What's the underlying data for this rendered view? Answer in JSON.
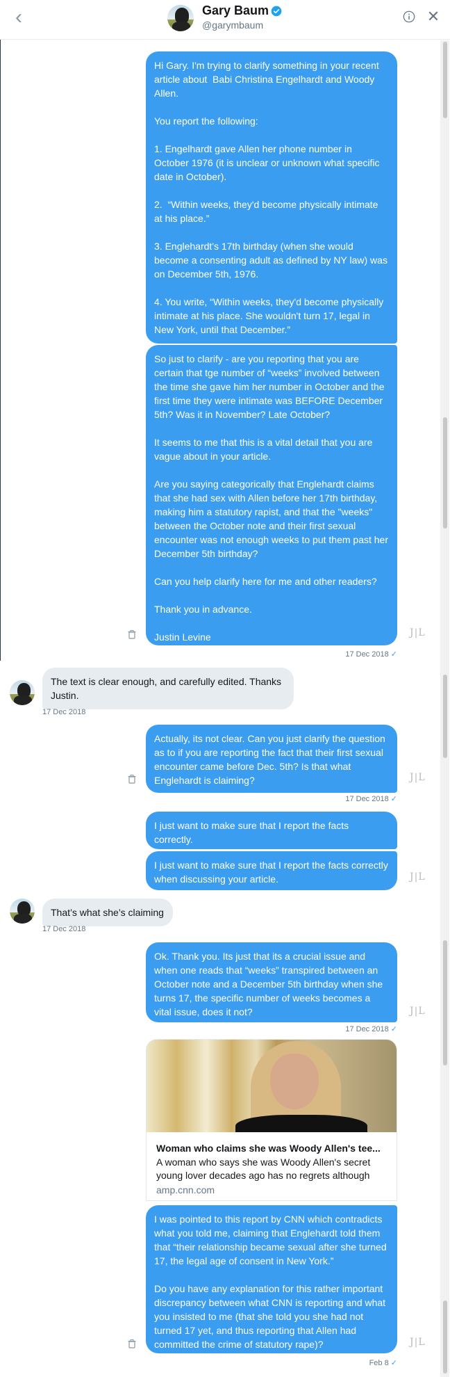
{
  "header": {
    "name": "Gary Baum",
    "handle": "@garymbaum"
  },
  "messages": {
    "m1a": "Hi Gary. I'm trying to clarify something in your recent article about  Babi Christina Engelhardt and Woody Allen.\n\nYou report the following:\n\n1. Engelhardt gave Allen her phone number in October 1976 (it is unclear or unknown what specific date in October).\n\n2.  “Within weeks, they'd become physically intimate at his place.”\n\n3. Englehardt's 17th birthday (when she would become a consenting adult as defined by NY law) was on December 5th, 1976.\n\n4. You write, “Within weeks, they'd become physically intimate at his place. She wouldn't turn 17, legal in New York, until that December.”",
    "m1b": "So just to clarify - are you reporting that you are certain that tge number of “weeks” involved between the time she gave him her number in October and the first time they were intimate was BEFORE December 5th? Was it in November? Late October?\n\nIt seems to me that this is a vital detail that you are vague about in your article.\n\nAre you saying categorically that Englehardt claims that she had sex with Allen before her 17th birthday, making him a statutory rapist, and that the \"weeks\" between the October note and their first sexual encounter was not enough weeks to put them past her December 5th birthday?\n\nCan you help clarify here for me and other readers?\n\nThank you in advance.\n\nJustin Levine",
    "ts1": "17 Dec 2018",
    "r1": "The text is clear enough, and carefully edited. Thanks Justin.",
    "ts_r1": "17 Dec 2018",
    "m2": "Actually, its not clear. Can you just clarify the question as to if you are reporting the fact that their first sexual encounter came before Dec. 5th? Is that what Englehardt is claiming?",
    "ts2": "17 Dec 2018",
    "m3a": "I just want to make sure that I report the facts correctly.",
    "m3b": "I just want to make sure that I report the facts correctly when discussing your article.",
    "r2": "That’s what she’s claiming",
    "ts_r2": "17 Dec 2018",
    "m4": "Ok. Thank you. Its just that its a crucial issue and when one reads that “weeks” transpired between an October note and a December 5th birthday when she turns 17, the specific number of weeks becomes a vital issue, does it not?",
    "ts4": "17 Dec 2018",
    "m5": "I was pointed to this report by CNN which contradicts what you told me, claiming that Englehardt told them that “their relationship became sexual after she turned 17, the legal age of consent in New York.”\n\nDo you have any explanation for this rather important discrepancy between what CNN is reporting and what you insisted to me (that she told you she had not turned 17 yet, and thus reporting that Allen had committed the crime of statutory rape)?",
    "ts5": "Feb 8"
  },
  "card": {
    "title": "Woman who claims she was Woody Allen's tee...",
    "description": "A woman who says she was Woody Allen's secret young lover decades ago has no regrets although",
    "domain": "amp.cnn.com"
  },
  "initials": "J|L",
  "check": "✓",
  "colors": {
    "sent_bubble": "#3b9df0",
    "received_bubble": "#e6ecf0",
    "timestamp": "#657786"
  },
  "icons": [
    "back-arrow-icon",
    "verified-badge-icon",
    "info-icon",
    "close-icon",
    "trash-icon",
    "check-icon"
  ]
}
